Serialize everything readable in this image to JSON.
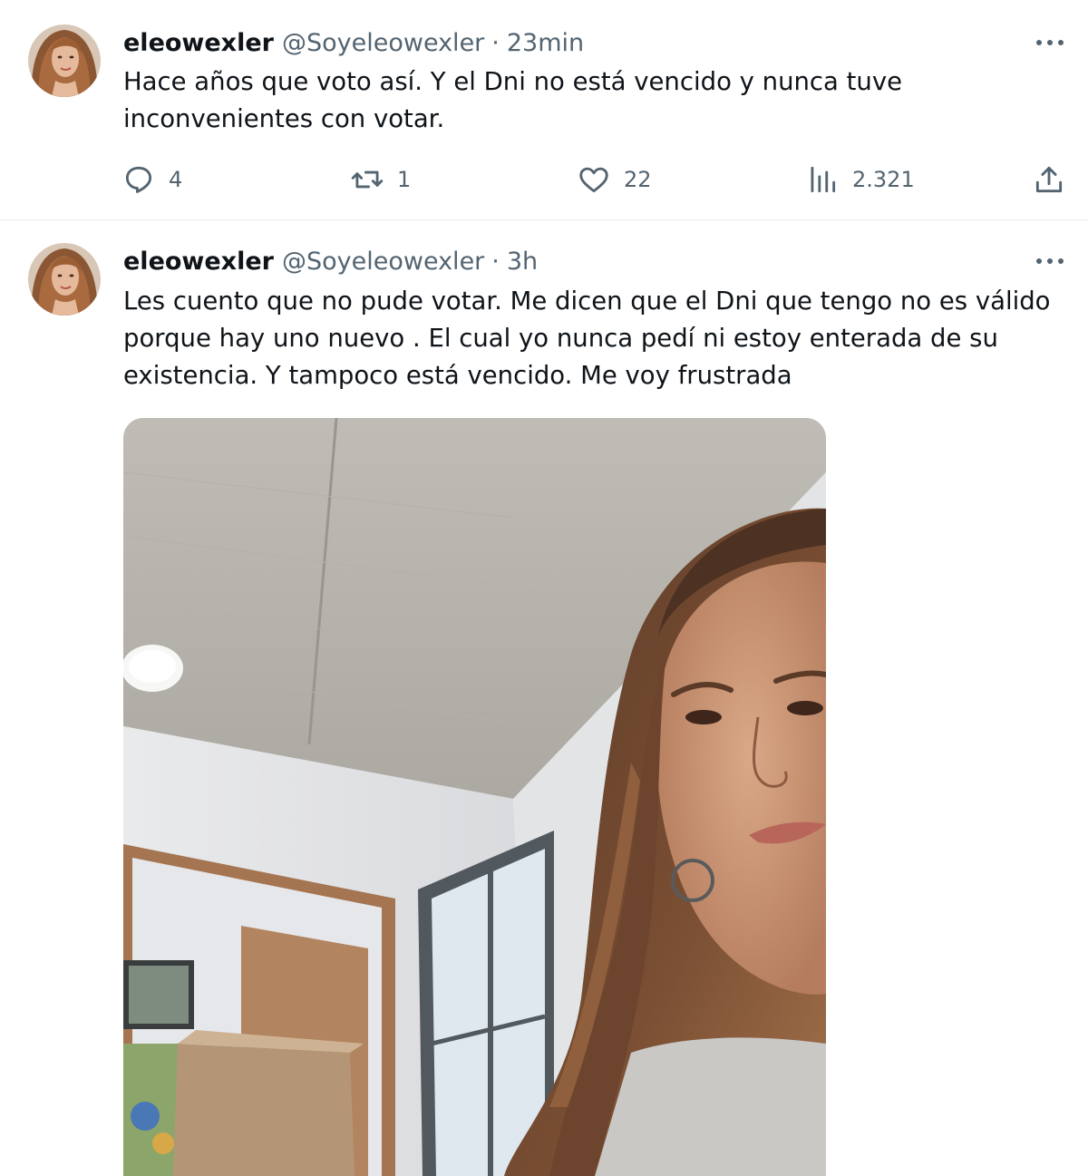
{
  "tweets": [
    {
      "author_name": "eleowexler",
      "author_handle": "@Soyeleowexler",
      "separator": "·",
      "time": "23min",
      "text": "Hace años que voto así. Y el Dni no está vencido y nunca tuve\ninconvenientes con votar.",
      "actions": {
        "replies": "4",
        "reposts": "1",
        "likes": "22",
        "views": "2.321"
      }
    },
    {
      "author_name": "eleowexler",
      "author_handle": "@Soyeleowexler",
      "separator": "·",
      "time": "3h",
      "text": "Les cuento que no pude votar. Me dicen que el Dni que tengo no es válido\nporque hay uno nuevo . El cual yo nunca pedí ni estoy enterada de su\nexistencia. Y tampoco está vencido. Me voy frustrada"
    }
  ],
  "icons": {
    "reply": "speech-bubble-icon",
    "repost": "repost-arrows-icon",
    "like": "heart-icon",
    "views": "bar-chart-icon",
    "share": "upload-arrow-icon",
    "more": "three-dots-icon"
  },
  "colors": {
    "text_primary": "#0f1419",
    "text_secondary": "#536471",
    "divider": "#e8ecee"
  }
}
